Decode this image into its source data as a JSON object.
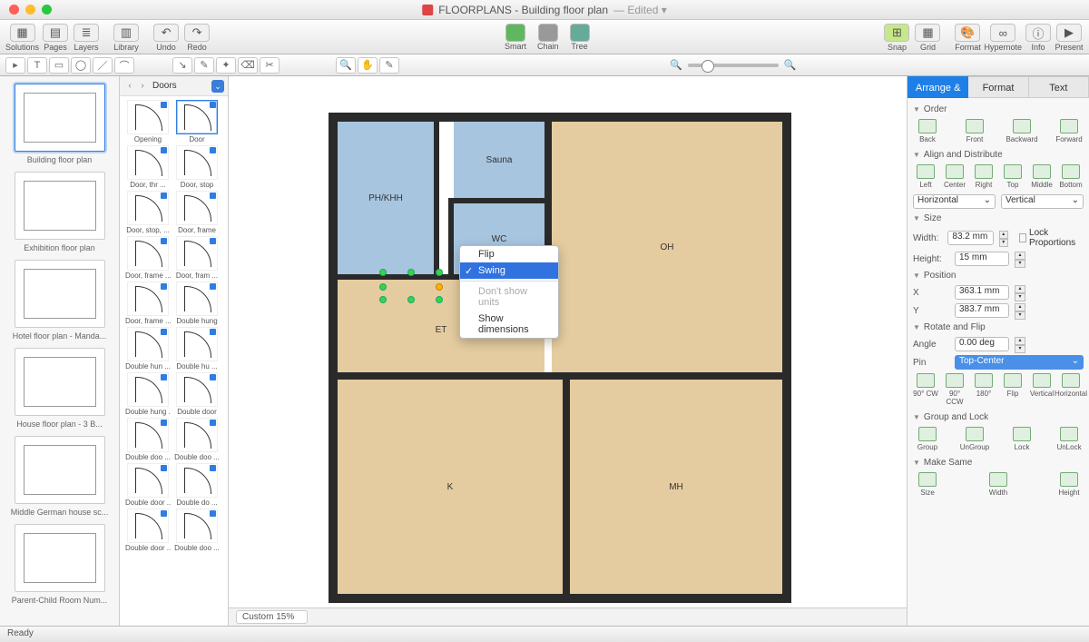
{
  "title": {
    "app": "FLOORPLANS",
    "doc": "Building floor plan",
    "edited": "— Edited ▾"
  },
  "toolbar": {
    "left": [
      {
        "l": "Solutions",
        "g": "▦"
      },
      {
        "l": "Pages",
        "g": "▤"
      },
      {
        "l": "Layers",
        "g": "≣"
      }
    ],
    "lib": {
      "l": "Library",
      "g": "▥"
    },
    "undo": {
      "l": "Undo",
      "g": "↶"
    },
    "redo": {
      "l": "Redo",
      "g": "↷"
    },
    "modes": [
      {
        "l": "Smart",
        "c": "s"
      },
      {
        "l": "Chain",
        "c": "c"
      },
      {
        "l": "Tree",
        "c": "t"
      }
    ],
    "snap": {
      "l": "Snap",
      "g": "⊞"
    },
    "grid": {
      "l": "Grid",
      "g": "▦"
    },
    "right": [
      {
        "l": "Format",
        "g": "🎨"
      },
      {
        "l": "Hypernote",
        "g": "∞"
      },
      {
        "l": "Info",
        "g": "ⓘ"
      },
      {
        "l": "Present",
        "g": "▶"
      }
    ]
  },
  "thumbs": [
    {
      "l": "Building floor plan",
      "sel": true
    },
    {
      "l": "Exhibition floor plan"
    },
    {
      "l": "Hotel floor plan - Manda..."
    },
    {
      "l": "House floor plan - 3 B..."
    },
    {
      "l": "Middle German house sc..."
    },
    {
      "l": "Parent-Child Room Num..."
    }
  ],
  "lib": {
    "title": "Doors",
    "items": [
      [
        "Opening",
        "Door"
      ],
      [
        "Door, thr ...",
        "Door, stop"
      ],
      [
        "Door, stop, ...",
        "Door, frame"
      ],
      [
        "Door, frame ...",
        "Door, fram ..."
      ],
      [
        "Door, frame ...",
        "Double hung"
      ],
      [
        "Double hun ...",
        "Double hu ..."
      ],
      [
        "Double hung ...",
        "Double door"
      ],
      [
        "Double doo ...",
        "Double doo ..."
      ],
      [
        "Double door ...",
        "Double do ..."
      ],
      [
        "Double door ...",
        "Double doo ..."
      ]
    ],
    "selected": 1
  },
  "rooms": {
    "ph": "PH/KHH",
    "sauna": "Sauna",
    "wc": "WC",
    "oh": "OH",
    "et": "ET",
    "k": "K",
    "mh": "MH"
  },
  "ctx": [
    "Flip",
    "Swing",
    "Don't show units",
    "Show dimensions"
  ],
  "zoom": {
    "label": "Custom 15%"
  },
  "rtabs": [
    "Arrange & Size",
    "Format",
    "Text"
  ],
  "r": {
    "order": {
      "h": "Order",
      "items": [
        "Back",
        "Front",
        "Backward",
        "Forward"
      ]
    },
    "align": {
      "h": "Align and Distribute",
      "items": [
        "Left",
        "Center",
        "Right",
        "Top",
        "Middle",
        "Bottom"
      ],
      "dist": [
        "Horizontal",
        "Vertical"
      ]
    },
    "size": {
      "h": "Size",
      "w": "Width:",
      "wv": "83.2 mm",
      "ht": "Height:",
      "hv": "15 mm",
      "lock": "Lock Proportions"
    },
    "pos": {
      "h": "Position",
      "x": "X",
      "xv": "363.1 mm",
      "y": "Y",
      "yv": "383.7 mm"
    },
    "rot": {
      "h": "Rotate and Flip",
      "angle": "Angle",
      "av": "0.00 deg",
      "pin": "Pin",
      "pinv": "Top-Center",
      "btns": [
        "90° CW",
        "90° CCW",
        "180°"
      ],
      "flip": "Flip",
      "flipb": [
        "Vertical",
        "Horizontal"
      ]
    },
    "grp": {
      "h": "Group and Lock",
      "items": [
        "Group",
        "UnGroup",
        "Lock",
        "UnLock"
      ]
    },
    "same": {
      "h": "Make Same",
      "items": [
        "Size",
        "Width",
        "Height"
      ]
    }
  },
  "status": "Ready"
}
